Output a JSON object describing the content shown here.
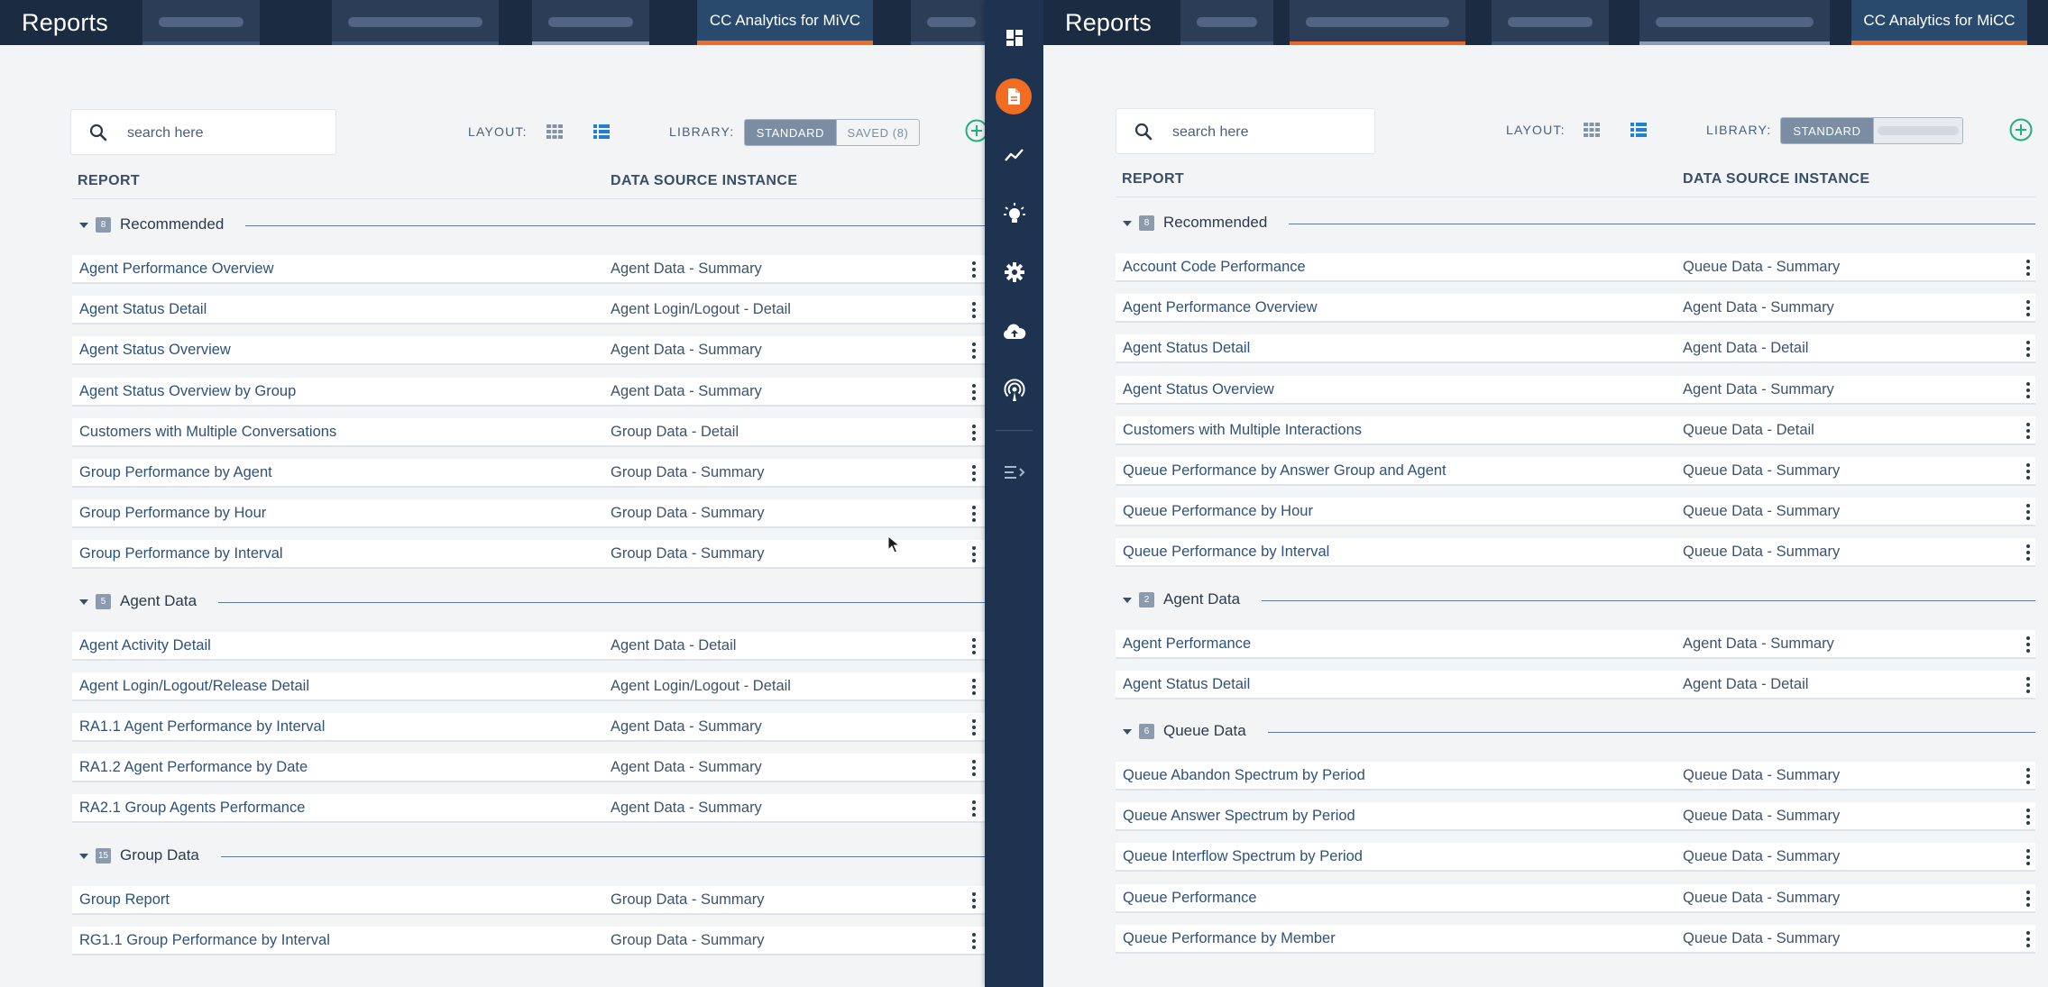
{
  "left": {
    "app_title": "Reports",
    "active_tab": "CC Analytics for MiVC",
    "search": {
      "placeholder": "search here"
    },
    "layout_label": "LAYOUT:",
    "library_label": "LIBRARY:",
    "library_standard": "STANDARD",
    "library_saved": "SAVED (8)",
    "columns": {
      "report": "REPORT",
      "data_source": "DATA SOURCE INSTANCE"
    },
    "sections": [
      {
        "name": "Recommended",
        "count": "8",
        "rows": [
          {
            "name": "Agent Performance Overview",
            "source": "Agent Data - Summary"
          },
          {
            "name": "Agent Status Detail",
            "source": "Agent Login/Logout - Detail"
          },
          {
            "name": "Agent Status Overview",
            "source": "Agent Data - Summary"
          },
          {
            "name": "Agent Status Overview by Group",
            "source": "Agent Data - Summary"
          },
          {
            "name": "Customers with Multiple Conversations",
            "source": "Group Data - Detail"
          },
          {
            "name": "Group Performance by Agent",
            "source": "Group Data - Summary"
          },
          {
            "name": "Group Performance by Hour",
            "source": "Group Data - Summary"
          },
          {
            "name": "Group Performance by Interval",
            "source": "Group Data - Summary"
          }
        ]
      },
      {
        "name": "Agent Data",
        "count": "5",
        "rows": [
          {
            "name": "Agent Activity Detail",
            "source": "Agent Data - Detail"
          },
          {
            "name": "Agent Login/Logout/Release Detail",
            "source": "Agent Login/Logout - Detail"
          },
          {
            "name": "RA1.1 Agent Performance by Interval",
            "source": "Agent Data - Summary"
          },
          {
            "name": "RA1.2 Agent Performance by Date",
            "source": "Agent Data - Summary"
          },
          {
            "name": "RA2.1 Group Agents Performance",
            "source": "Agent Data - Summary"
          }
        ]
      },
      {
        "name": "Group Data",
        "count": "15",
        "rows": [
          {
            "name": "Group Report",
            "source": "Group Data - Summary"
          },
          {
            "name": "RG1.1 Group Performance by Interval",
            "source": "Group Data - Summary"
          }
        ]
      }
    ]
  },
  "right": {
    "app_title": "Reports",
    "active_tab": "CC Analytics for MiCC",
    "search": {
      "placeholder": "search here"
    },
    "layout_label": "LAYOUT:",
    "library_label": "LIBRARY:",
    "library_standard": "STANDARD",
    "columns": {
      "report": "REPORT",
      "data_source": "DATA SOURCE INSTANCE"
    },
    "sections": [
      {
        "name": "Recommended",
        "count": "8",
        "rows": [
          {
            "name": "Account Code Performance",
            "source": "Queue Data - Summary"
          },
          {
            "name": "Agent Performance Overview",
            "source": "Agent Data - Summary"
          },
          {
            "name": "Agent Status Detail",
            "source": "Agent Data - Detail"
          },
          {
            "name": "Agent Status Overview",
            "source": "Agent Data - Summary"
          },
          {
            "name": "Customers with Multiple Interactions",
            "source": "Queue Data - Detail"
          },
          {
            "name": "Queue Performance by Answer Group and Agent",
            "source": "Queue Data - Summary"
          },
          {
            "name": "Queue Performance by Hour",
            "source": "Queue Data - Summary"
          },
          {
            "name": "Queue Performance by Interval",
            "source": "Queue Data - Summary"
          }
        ]
      },
      {
        "name": "Agent Data",
        "count": "2",
        "rows": [
          {
            "name": "Agent Performance",
            "source": "Agent Data - Summary"
          },
          {
            "name": "Agent Status Detail",
            "source": "Agent Data - Detail"
          }
        ]
      },
      {
        "name": "Queue Data",
        "count": "6",
        "rows": [
          {
            "name": "Queue Abandon Spectrum by Period",
            "source": "Queue Data - Summary"
          },
          {
            "name": "Queue Answer Spectrum by Period",
            "source": "Queue Data - Summary"
          },
          {
            "name": "Queue Interflow Spectrum by Period",
            "source": "Queue Data - Summary"
          },
          {
            "name": "Queue Performance",
            "source": "Queue Data - Summary"
          },
          {
            "name": "Queue Performance by Member",
            "source": "Queue Data - Summary"
          }
        ]
      }
    ]
  },
  "nav_icons": [
    "dashboard-icon",
    "reports-icon",
    "trends-icon",
    "insights-icon",
    "settings-icon",
    "cloud-upload-icon",
    "broadcast-icon",
    "expand-menu-icon"
  ]
}
